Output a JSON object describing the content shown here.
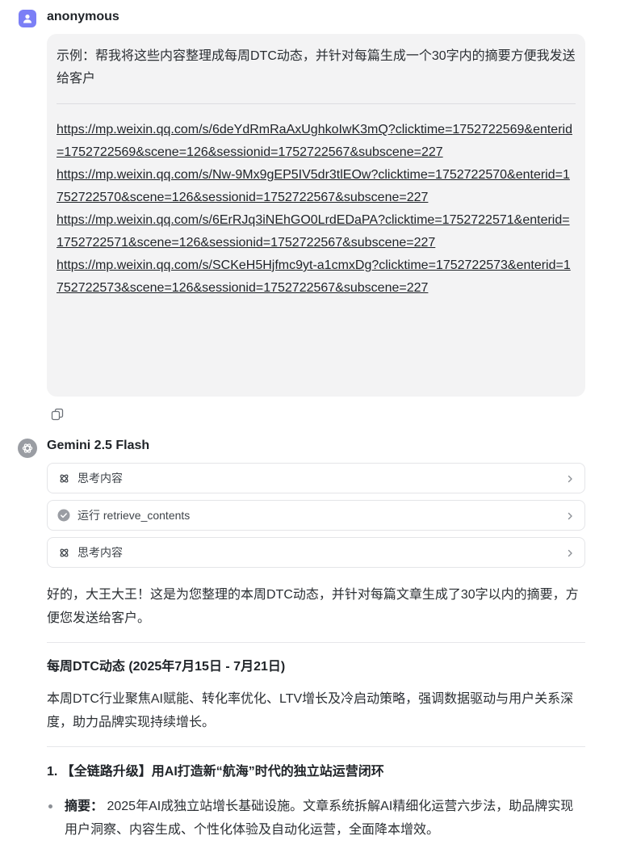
{
  "user": {
    "name": "anonymous",
    "prompt": "示例：帮我将这些内容整理成每周DTC动态，并针对每篇生成一个30字内的摘要方便我发送给客户",
    "links": [
      "https://mp.weixin.qq.com/s/6deYdRmRaAxUghkoIwK3mQ?clicktime=1752722569&enterid=1752722569&scene=126&sessionid=1752722567&subscene=227",
      "https://mp.weixin.qq.com/s/Nw-9Mx9gEP5IV5dr3tlEOw?clicktime=1752722570&enterid=1752722570&scene=126&sessionid=1752722567&subscene=227",
      "https://mp.weixin.qq.com/s/6ErRJq3iNEhGO0LrdEDaPA?clicktime=1752722571&enterid=1752722571&scene=126&sessionid=1752722567&subscene=227",
      "https://mp.weixin.qq.com/s/SCKeH5Hjfmc9yt-a1cmxDg?clicktime=1752722573&enterid=1752722573&scene=126&sessionid=1752722567&subscene=227"
    ]
  },
  "bot": {
    "name": "Gemini 2.5 Flash",
    "steps": [
      {
        "label": "思考内容",
        "icon": "thinking-icon"
      },
      {
        "label": "运行 retrieve_contents",
        "icon": "check-circle-icon"
      },
      {
        "label": "思考内容",
        "icon": "thinking-icon"
      }
    ],
    "intro": "好的，大王大王！这是为您整理的本周DTC动态，并针对每篇文章生成了30字以内的摘要，方便您发送给客户。",
    "heading": "每周DTC动态 (2025年7月15日 - 7月21日)",
    "overview": "本周DTC行业聚焦AI赋能、转化率优化、LTV增长及冷启动策略，强调数据驱动与用户关系深度，助力品牌实现持续增长。",
    "item1_title": "1. 【全链路升级】用AI打造新“航海”时代的独立站运营闭环",
    "item1_summary_label": "摘要：",
    "item1_summary": "2025年AI成独立站增长基础设施。文章系统拆解AI精细化运营六步法，助品牌实现用户洞察、内容生成、个性化体验及自动化运营，全面降本增效。"
  },
  "colors": {
    "user_avatar": "#7b7ff6",
    "bubble_bg": "#f3f3f4",
    "border": "#e4e5e8"
  }
}
